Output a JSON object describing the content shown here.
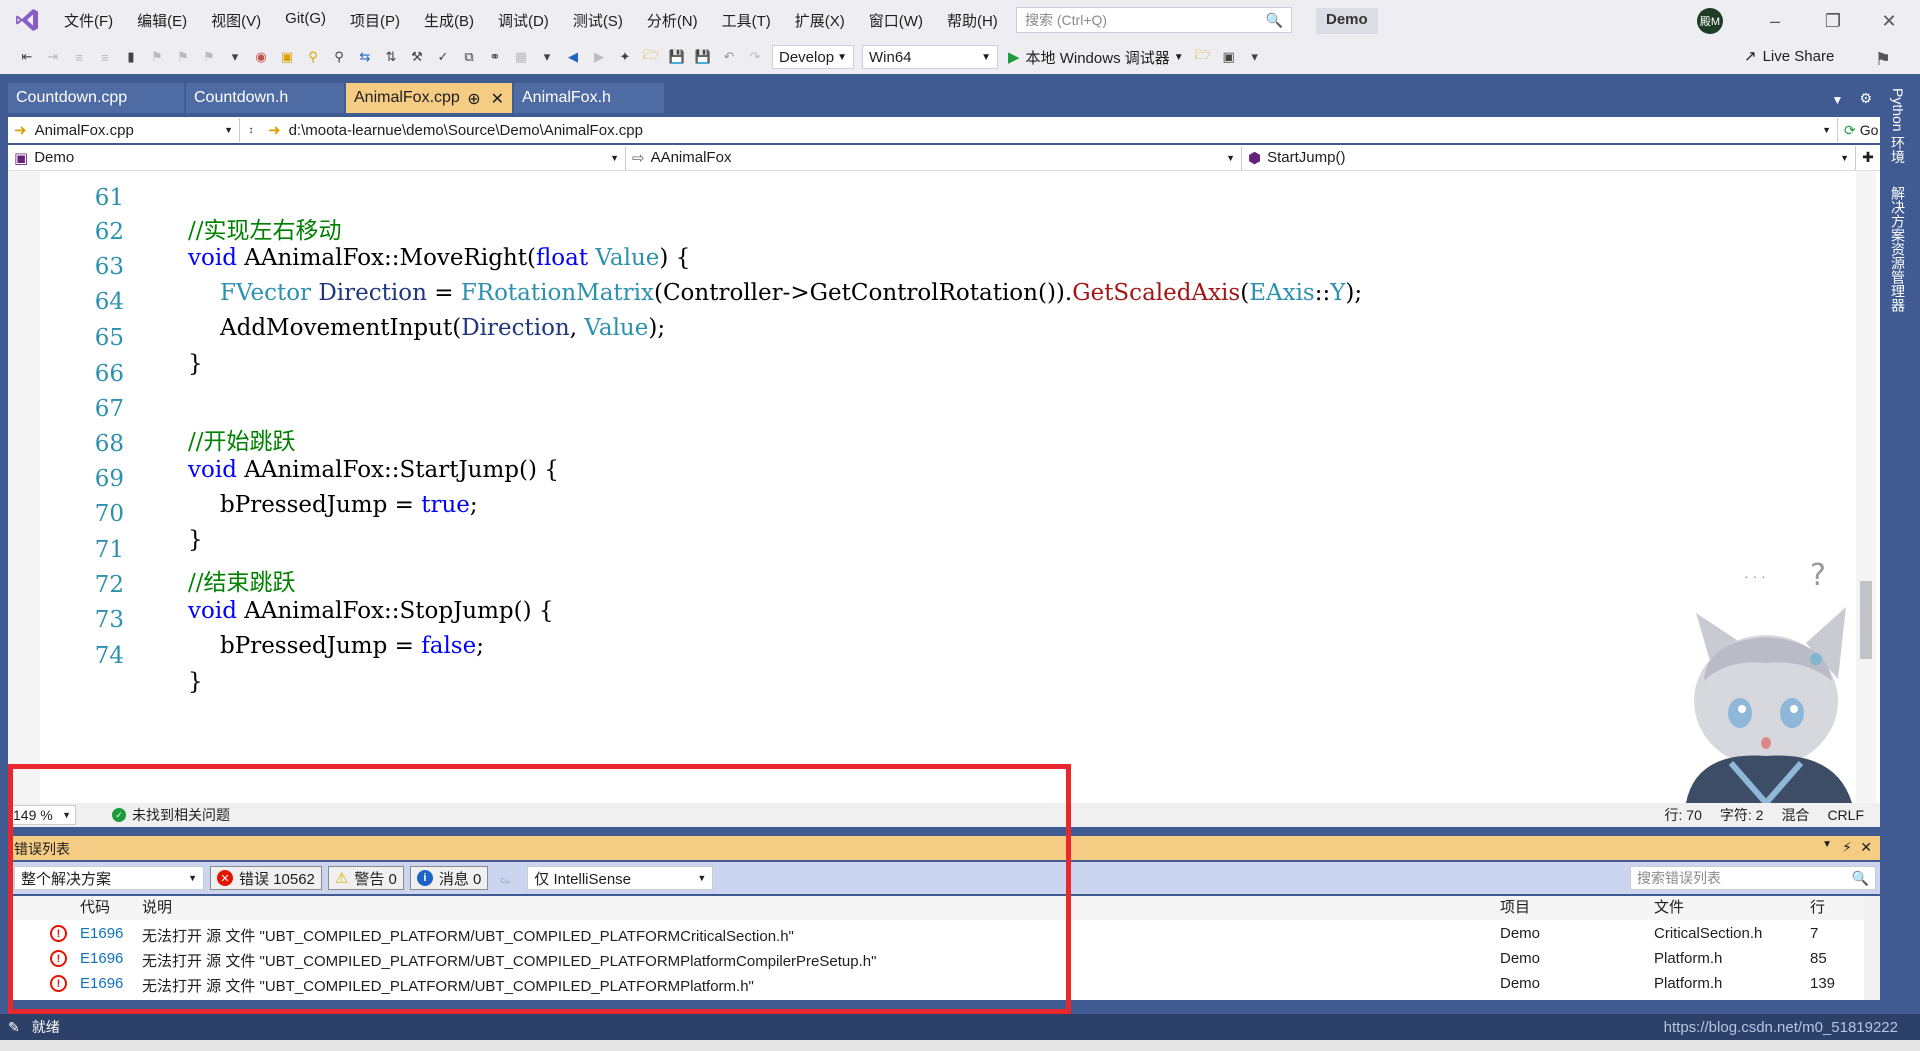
{
  "menubar": {
    "items": [
      "文件(F)",
      "编辑(E)",
      "视图(V)",
      "Git(G)",
      "项目(P)",
      "生成(B)",
      "调试(D)",
      "测试(S)",
      "分析(N)",
      "工具(T)",
      "扩展(X)",
      "窗口(W)",
      "帮助(H)"
    ],
    "search_placeholder": "搜索 (Ctrl+Q)",
    "solution_name": "Demo",
    "avatar_text": "殿M"
  },
  "toolbar": {
    "config": "Develop",
    "platform": "Win64",
    "debugger": "本地 Windows 调试器",
    "live_share": "Live Share"
  },
  "tabs": [
    "Countdown.cpp",
    "Countdown.h",
    "AnimalFox.cpp",
    "AnimalFox.h"
  ],
  "navbar": {
    "file": "AnimalFox.cpp",
    "path": "d:\\moota-learnue\\demo\\Source\\Demo\\AnimalFox.cpp",
    "go": "Go",
    "project": "Demo",
    "class": "AAnimalFox",
    "member": "StartJump()"
  },
  "code_lines": [
    {
      "n": "61",
      "text": "//实现左右移动"
    },
    {
      "n": "62",
      "text": "void AAnimalFox::MoveRight(float Value) {"
    },
    {
      "n": "63",
      "text": "FVector Direction = FRotationMatrix(Controller->GetControlRotation()).GetScaledAxis(EAxis::Y);"
    },
    {
      "n": "64",
      "text": "AddMovementInput(Direction, Value);"
    },
    {
      "n": "65",
      "text": "}"
    },
    {
      "n": "66",
      "text": ""
    },
    {
      "n": "67",
      "text": "//开始跳跃"
    },
    {
      "n": "68",
      "text": "void AAnimalFox::StartJump() {"
    },
    {
      "n": "69",
      "text": "bPressedJump = true;"
    },
    {
      "n": "70",
      "text": "}"
    },
    {
      "n": "71",
      "text": "//结束跳跃"
    },
    {
      "n": "72",
      "text": "void AAnimalFox::StopJump() {"
    },
    {
      "n": "73",
      "text": "bPressedJump = false;"
    },
    {
      "n": "74",
      "text": "}"
    }
  ],
  "editor_status": {
    "zoom": "149 %",
    "issues": "未找到相关问题",
    "line": "行: 70",
    "char": "字符: 2",
    "mode": "混合",
    "eol": "CRLF"
  },
  "error_list": {
    "title": "错误列表",
    "scope": "整个解决方案",
    "errors": "错误 10562",
    "warnings": "警告 0",
    "messages": "消息 0",
    "filter": "仅 IntelliSense",
    "search_placeholder": "搜索错误列表",
    "columns": {
      "code": "代码",
      "desc": "说明",
      "project": "项目",
      "file": "文件",
      "line": "行"
    },
    "rows": [
      {
        "code": "E1696",
        "desc": "无法打开 源 文件 \"UBT_COMPILED_PLATFORM/UBT_COMPILED_PLATFORMCriticalSection.h\"",
        "project": "Demo",
        "file": "CriticalSection.h",
        "line": "7"
      },
      {
        "code": "E1696",
        "desc": "无法打开 源 文件 \"UBT_COMPILED_PLATFORM/UBT_COMPILED_PLATFORMPlatformCompilerPreSetup.h\"",
        "project": "Demo",
        "file": "Platform.h",
        "line": "85"
      },
      {
        "code": "E1696",
        "desc": "无法打开 源 文件 \"UBT_COMPILED_PLATFORM/UBT_COMPILED_PLATFORMPlatform.h\"",
        "project": "Demo",
        "file": "Platform.h",
        "line": "139"
      }
    ]
  },
  "statusbar": {
    "ready": "就绪",
    "url": "https://blog.csdn.net/m0_51819222"
  },
  "side_panel": [
    "Python 环境",
    "解决方案资源管理器"
  ],
  "colors": {
    "frame": "#3f5b91",
    "active_tab": "#f5cc84",
    "error_red": "#e51400",
    "highlight_box": "#e8282d"
  }
}
